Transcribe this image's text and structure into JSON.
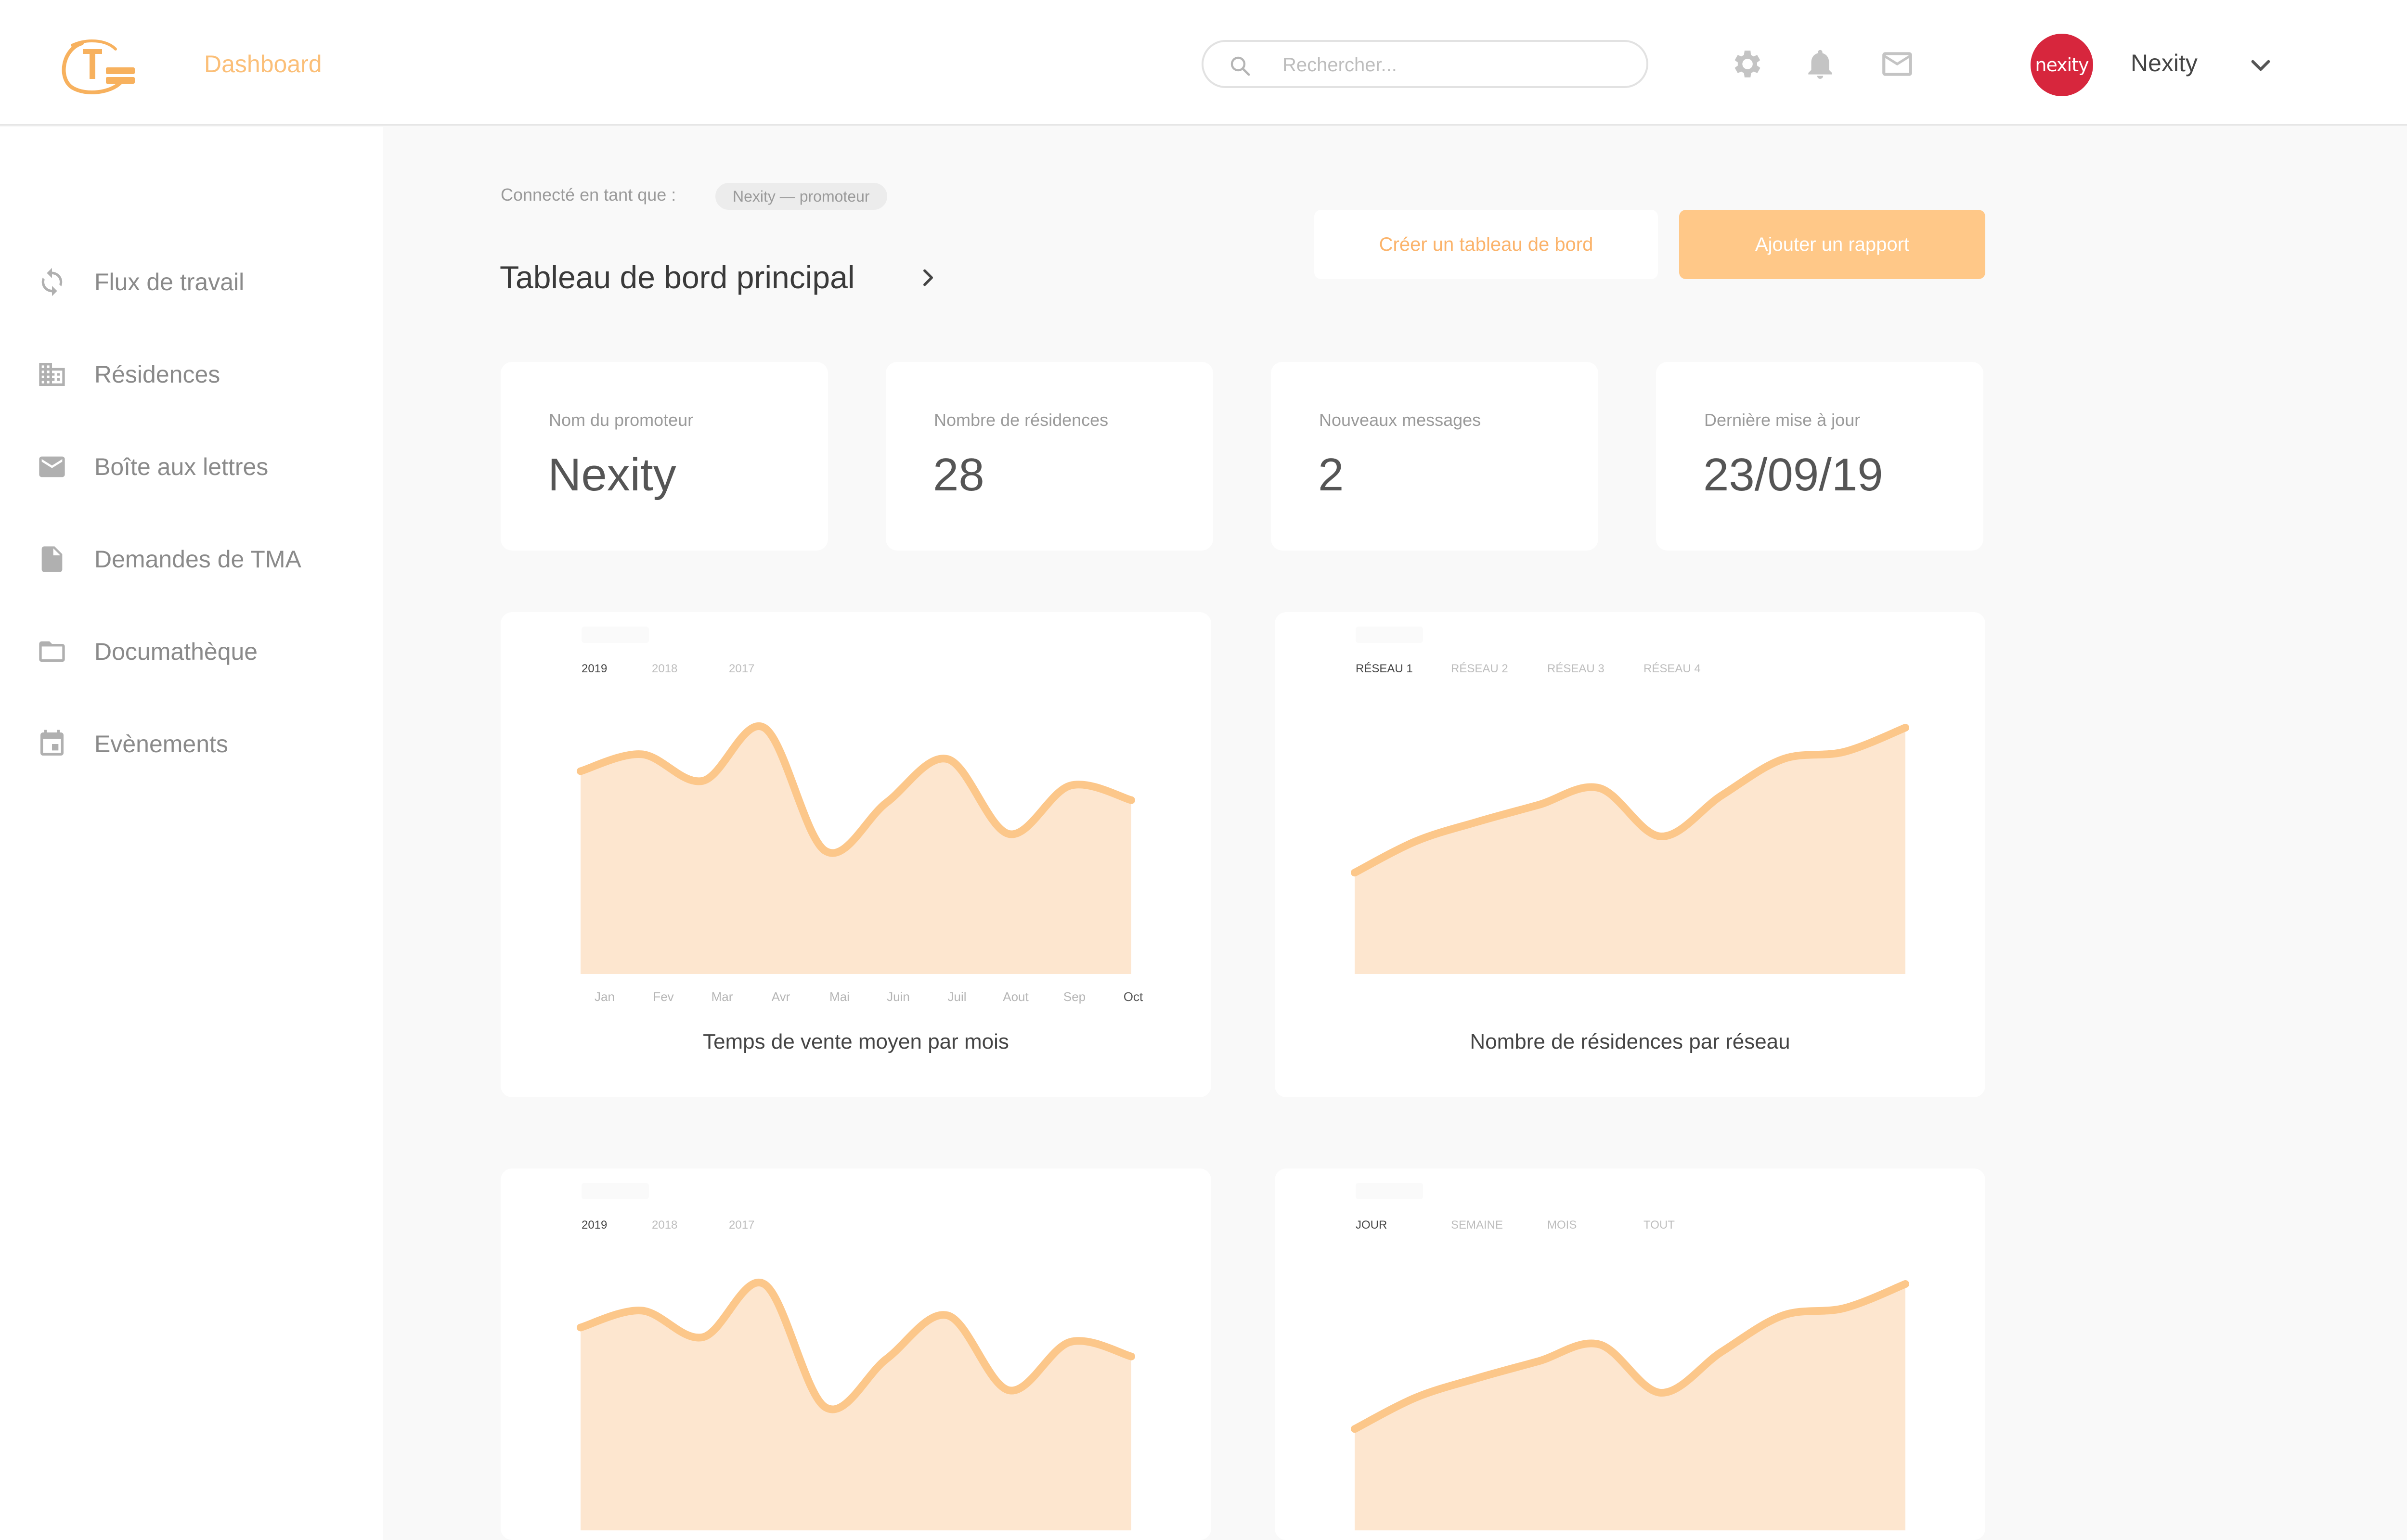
{
  "header": {
    "nav_dashboard": "Dashboard",
    "search_placeholder": "Rechercher...",
    "avatar_text": "nexity",
    "user_name": "Nexity",
    "brand_color": "#fbbf78",
    "icons": [
      "gear-icon",
      "bell-icon",
      "mail-icon",
      "chevron-down-icon"
    ]
  },
  "sidebar": {
    "items": [
      {
        "label": "Flux de travail",
        "icon": "sync-icon"
      },
      {
        "label": "Résidences",
        "icon": "building-icon"
      },
      {
        "label": "Boîte aux lettres",
        "icon": "mail-icon"
      },
      {
        "label": "Demandes de TMA",
        "icon": "file-icon"
      },
      {
        "label": "Documathèque",
        "icon": "folder-icon"
      },
      {
        "label": "Evènements",
        "icon": "calendar-icon"
      }
    ]
  },
  "main": {
    "connected_label": "Connecté en tant que :",
    "role_chip": "Nexity — promoteur",
    "title": "Tableau de bord principal",
    "btn_create": "Créer un tableau de bord",
    "btn_add": "Ajouter un rapport",
    "stats": [
      {
        "label": "Nom du promoteur",
        "value": "Nexity"
      },
      {
        "label": "Nombre de résidences",
        "value": "28"
      },
      {
        "label": "Nouveaux messages",
        "value": "2"
      },
      {
        "label": "Dernière mise à jour",
        "value": "23/09/19"
      }
    ]
  },
  "chart_data": [
    {
      "type": "area",
      "title": "Temps de vente moyen par mois",
      "tabs": [
        "2019",
        "2018",
        "2017"
      ],
      "active_tab": "2019",
      "categories": [
        "Jan",
        "Fev",
        "Mar",
        "Avr",
        "Mai",
        "Juin",
        "Juil",
        "Aout",
        "Sep",
        "Oct"
      ],
      "highlight_category": "Oct",
      "series": [
        {
          "values": [
            0.78,
            0.85,
            0.74,
            0.96,
            0.45,
            0.65,
            0.83,
            0.52,
            0.72,
            0.66
          ]
        }
      ],
      "color": "#fcc78a",
      "fill": "#fde6cf",
      "ylim": [
        0,
        1
      ]
    },
    {
      "type": "area",
      "title": "Nombre de résidences par réseau",
      "tabs": [
        "RÉSEAU 1",
        "RÉSEAU 2",
        "RÉSEAU 3",
        "RÉSEAU 4"
      ],
      "active_tab": "RÉSEAU 1",
      "series": [
        {
          "values": [
            0.36,
            0.49,
            0.57,
            0.64,
            0.71,
            0.51,
            0.68,
            0.83,
            0.86,
            0.96
          ]
        }
      ],
      "color": "#fcc78a",
      "fill": "#fde6cf",
      "ylim": [
        0,
        1
      ]
    },
    {
      "type": "area",
      "title": "",
      "tabs": [
        "2019",
        "2018",
        "2017"
      ],
      "active_tab": "2019",
      "series": [
        {
          "values": [
            0.78,
            0.85,
            0.74,
            0.96,
            0.45,
            0.65,
            0.83,
            0.52,
            0.72,
            0.66
          ]
        }
      ],
      "color": "#fcc78a",
      "fill": "#fde6cf",
      "ylim": [
        0,
        1
      ]
    },
    {
      "type": "area",
      "title": "",
      "tabs": [
        "JOUR",
        "SEMAINE",
        "MOIS",
        "TOUT"
      ],
      "active_tab": "JOUR",
      "series": [
        {
          "values": [
            0.36,
            0.49,
            0.57,
            0.64,
            0.71,
            0.51,
            0.68,
            0.83,
            0.86,
            0.96
          ]
        }
      ],
      "color": "#fcc78a",
      "fill": "#fde6cf",
      "ylim": [
        0,
        1
      ]
    }
  ]
}
